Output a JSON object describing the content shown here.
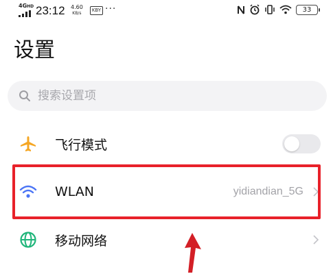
{
  "status_bar": {
    "network": "4G",
    "network_sub": "HD",
    "time": "23:12",
    "speed_value": "4.60",
    "speed_unit": "KB/s",
    "kb_badge": "KBY",
    "more": "···",
    "battery": "33",
    "icons": [
      "nfc-icon",
      "alarm-icon",
      "vibrate-icon",
      "wifi-icon",
      "battery-icon"
    ]
  },
  "page": {
    "title": "设置"
  },
  "search": {
    "placeholder": "搜索设置项"
  },
  "settings": [
    {
      "label": "飞行模式",
      "icon": "airplane-icon",
      "toggle": false
    },
    {
      "label": "WLAN",
      "icon": "wifi-icon",
      "value": "yidiandian_5G"
    },
    {
      "label": "移动网络",
      "icon": "globe-icon"
    }
  ],
  "colors": {
    "highlight": "#e8212a",
    "arrow": "#d31f26",
    "airplane": "#f5a623",
    "wifi": "#4a74f5",
    "globe": "#1fb57a"
  }
}
